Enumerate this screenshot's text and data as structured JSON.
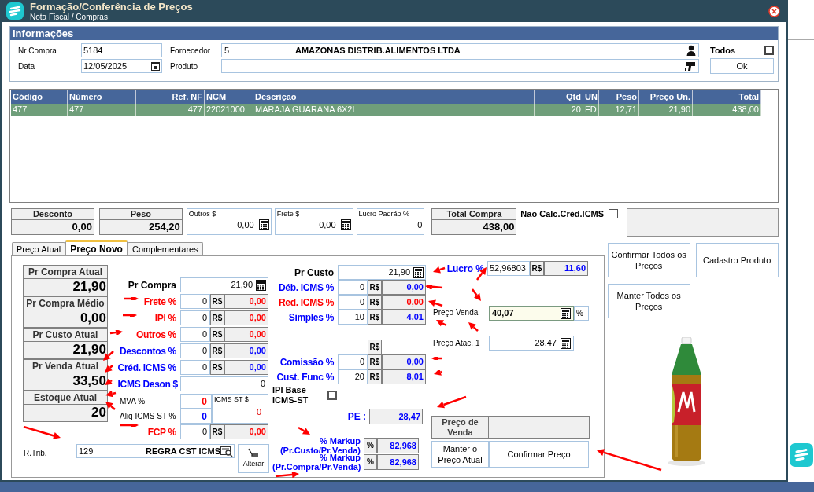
{
  "window": {
    "title": "Formação/Conferência de Preços",
    "subtitle": "Nota Fiscal / Compras"
  },
  "info": {
    "title": "Informações",
    "nr_compra": {
      "label": "Nr Compra",
      "value": "5184"
    },
    "data": {
      "label": "Data",
      "value": "12/05/2025"
    },
    "fornecedor": {
      "label": "Fornecedor",
      "code": "5",
      "name": "AMAZONAS DISTRIB.ALIMENTOS LTDA"
    },
    "produto": {
      "label": "Produto"
    },
    "todos": {
      "label": "Todos",
      "checked": false
    },
    "ok_button": "Ok"
  },
  "table": {
    "columns": [
      {
        "label": "Código"
      },
      {
        "label": "Número"
      },
      {
        "label": "Ref. NF"
      },
      {
        "label": "NCM"
      },
      {
        "label": "Descrição"
      },
      {
        "label": "Qtd"
      },
      {
        "label": "UN"
      },
      {
        "label": "Peso"
      },
      {
        "label": "Preço Un."
      },
      {
        "label": "Total"
      }
    ],
    "rows": [
      {
        "selected": true,
        "cells": [
          "477",
          "477",
          "477",
          "22021000",
          "MARAJA GUARANA 6X2L",
          "20",
          "FD",
          "12,71",
          "21,90",
          "438,00"
        ]
      }
    ]
  },
  "summary": [
    {
      "kind": "labeled",
      "label": "Desconto",
      "value": "0,00"
    },
    {
      "kind": "labeled",
      "label": "Peso",
      "value": "254,20"
    },
    {
      "kind": "field",
      "label": "Outros $",
      "value": "0,00",
      "calculator": true
    },
    {
      "kind": "field",
      "label": "Frete $",
      "value": "0,00",
      "calculator": true
    },
    {
      "kind": "field",
      "label": "Lucro Padrão %",
      "value": "0",
      "calculator": false
    },
    {
      "kind": "labeled",
      "label": "Total Compra",
      "value": "438,00"
    }
  ],
  "nao_calc": {
    "label": "Não Calc.Créd.ICMS",
    "checked": false
  },
  "tabs": [
    {
      "label": "Preço Atual",
      "selected": false
    },
    {
      "label": "Preço Novo",
      "selected": true
    },
    {
      "label": "Complementares",
      "selected": false
    }
  ],
  "current": [
    {
      "label": "Pr Compra Atual",
      "value": "21,90"
    },
    {
      "label": "Pr Compra Médio",
      "value": "0,00"
    },
    {
      "label": "Pr Custo Atual",
      "value": "21,90"
    },
    {
      "label": "Pr Venda Atual",
      "value": "33,50"
    },
    {
      "label": "Estoque Atual",
      "value": "20"
    }
  ],
  "purchase": [
    {
      "kind": "input",
      "label": "Pr Compra",
      "value": "21,90"
    },
    {
      "kind": "pct",
      "label": "Frete %",
      "color": "#ff0000",
      "percent": "0",
      "currency": "R$",
      "amount": "0,00"
    },
    {
      "kind": "pct",
      "label": "IPI %",
      "color": "#ff0000",
      "percent": "0",
      "currency": "R$",
      "amount": "0,00"
    },
    {
      "kind": "pct",
      "label": "Outros %",
      "color": "#ff0000",
      "percent": "0",
      "currency": "R$",
      "amount": "0,00"
    },
    {
      "kind": "pct",
      "label": "Descontos %",
      "color": "#0000ff",
      "percent": "0",
      "currency": "R$",
      "amount": "0,00"
    },
    {
      "kind": "pct",
      "label": "Créd. ICMS %",
      "color": "#0000ff",
      "percent": "0",
      "currency": "R$",
      "amount": "0,00"
    },
    {
      "kind": "single",
      "label": "ICMS Deson $",
      "color": "#0000ff",
      "value": "0"
    },
    {
      "kind": "st",
      "rows": [
        {
          "label": "MVA %",
          "value": "0",
          "color": "#ff0000"
        },
        {
          "label": "Aliq ICMS ST %",
          "value": "0",
          "color": "#0000ff"
        }
      ],
      "box_label": "ICMS ST $",
      "box_value": "0"
    },
    {
      "kind": "pct",
      "label": "FCP %",
      "color": "#ff0000",
      "percent": "0",
      "currency": "R$",
      "amount": "0,00"
    }
  ],
  "rtrib": {
    "label": "R.Trib.",
    "code": "129",
    "name": "REGRA CST ICMS",
    "button": "Alterar"
  },
  "cost": [
    {
      "kind": "input",
      "label": "Pr Custo",
      "color": "#000000",
      "value": "21,90"
    },
    {
      "kind": "pct",
      "label": "Déb. ICMS %",
      "color": "#0000ff",
      "percent": "0",
      "currency": "R$",
      "amount": "0,00"
    },
    {
      "kind": "pct",
      "label": "Red. ICMS %",
      "color": "#ff0000",
      "percent": "0",
      "currency": "R$",
      "amount": "0,00"
    },
    {
      "kind": "pct",
      "label": "Simples %",
      "color": "#0000ff",
      "percent": "10",
      "currency": "R$",
      "amount": "4,01"
    },
    {
      "kind": "header",
      "currency": "R$"
    },
    {
      "kind": "pct",
      "label": "Comissão %",
      "color": "#0000ff",
      "percent": "0",
      "currency": "R$",
      "amount": "0,00"
    },
    {
      "kind": "pct",
      "label": "Cust. Func %",
      "color": "#0000ff",
      "percent": "20",
      "currency": "R$",
      "amount": "8,01"
    },
    {
      "kind": "check",
      "label": "IPI Base ICMS-ST",
      "checked": false
    },
    {
      "kind": "readout",
      "label": "PE :",
      "value": "28,47"
    },
    {
      "kind": "markup",
      "label": "% Markup (Pr.Custo/Pr.Venda)",
      "unit": "%",
      "value": "82,968"
    },
    {
      "kind": "markup",
      "label": "% Markup (Pr.Compra/Pr.Venda)",
      "unit": "%",
      "value": "82,968"
    }
  ],
  "sale": {
    "lucro": {
      "label": "Lucro %",
      "value": "52,96803",
      "currency": "R$",
      "amount": "11,60"
    },
    "preco_venda": {
      "label": "Preço Venda",
      "value": "40,07",
      "unit": "%"
    },
    "preco_atac": {
      "label": "Preço Atac. 1",
      "value": "28,47"
    },
    "preco_de_venda": {
      "label": "Preço de Venda"
    },
    "buttons": [
      "Manter o Preço Atual",
      "Confirmar Preço"
    ]
  },
  "side_buttons": [
    "Confirmar Todos os Preços",
    "Cadastro Produto",
    "Manter Todos os Preços"
  ]
}
